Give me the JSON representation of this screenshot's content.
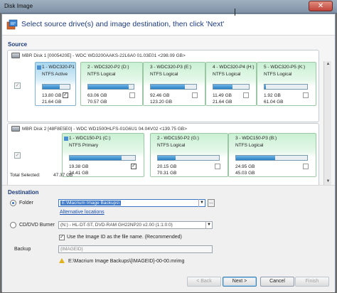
{
  "window": {
    "title": "Disk Image",
    "close_label": "✕"
  },
  "header": {
    "heading": "Select source drive(s) and image destination, then click 'Next'"
  },
  "source": {
    "label": "Source",
    "disks": [
      {
        "header": "MBR Disk 1 [0005420E] - WDC WD3200AAKS-22L6A0 01.03E01  <298.09 GB>",
        "partitions": [
          {
            "name": "1 - WDC320-P1 (O:",
            "type": "NTFS Active",
            "used": "13.80 GB",
            "total": "21.64 GB",
            "fill": 0.64,
            "checked": true,
            "selected": true
          },
          {
            "name": "2 - WDC320-P2 (D:)",
            "type": "NTFS Logical",
            "used": "63.06 GB",
            "total": "70.57 GB",
            "fill": 0.89,
            "checked": false,
            "selected": false
          },
          {
            "name": "3 - WDC320-P3 (E:)",
            "type": "NTFS Logical",
            "used": "92.46 GB",
            "total": "123.20 GB",
            "fill": 0.75,
            "checked": false,
            "selected": false
          },
          {
            "name": "4 - WDC320-P4 (H:)",
            "type": "NTFS Logical",
            "used": "11.49 GB",
            "total": "21.64 GB",
            "fill": 0.53,
            "checked": false,
            "selected": false
          },
          {
            "name": "5 - WDC320-P5 (K:)",
            "type": "NTFS Logical",
            "used": "1.92 GB",
            "total": "61.04 GB",
            "fill": 0.03,
            "checked": false,
            "selected": false
          }
        ]
      },
      {
        "header": "MBR Disk 2 [48F8E5E0] - WDC WD1500HLFS-01G6U1 04.04V02  <139.75 GB>",
        "partitions": [
          {
            "name": "1 - WDC150-P1 (C:)",
            "type": "NTFS Primary",
            "used": "19.38 GB",
            "total": "24.41 GB",
            "fill": 0.79,
            "checked": true,
            "selected": false
          },
          {
            "name": "2 - WDC150-P2 (G:)",
            "type": "NTFS Logical",
            "used": "20.15 GB",
            "total": "70.31 GB",
            "fill": 0.29,
            "checked": false,
            "selected": false
          },
          {
            "name": "3 - WDC150-P3 (B:)",
            "type": "NTFS Logical",
            "used": "24.95 GB",
            "total": "45.03 GB",
            "fill": 0.55,
            "checked": false,
            "selected": false
          }
        ]
      }
    ],
    "total_label": "Total Selected:",
    "total_value": "47.37 GB"
  },
  "destination": {
    "label": "Destination",
    "folder_label": "Folder",
    "folder_value": "E:\\Macrium Image Backups\\",
    "browse_label": "...",
    "alt_locations": "Alternative locations",
    "cd_label": "CD/DVD Burner",
    "cd_value": "(N:) - HL-DT-ST, DVD-RAM GH22NP20 v2.00 (1:1:0:0)",
    "use_id_label": "Use the Image ID as the file name.  (Recommended)",
    "backup_label": "Backup",
    "backup_value": "{IMAGEID}",
    "path_preview": "E:\\Macrium Image Backups\\{IMAGEID}-00-00.mrimg"
  },
  "footer": {
    "back": "< Back",
    "next": "Next >",
    "cancel": "Cancel",
    "finish": "Finish"
  }
}
